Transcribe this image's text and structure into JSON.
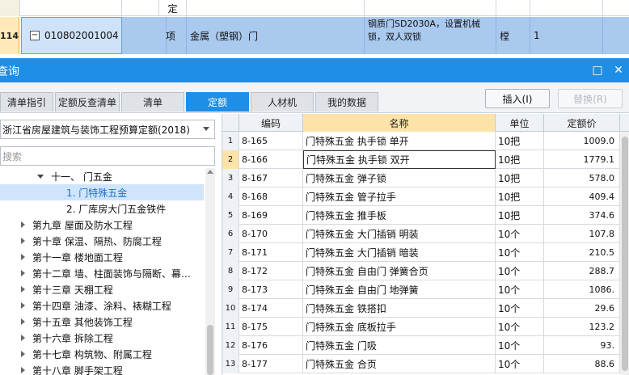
{
  "top_grid": {
    "row1_unit": "定",
    "row_number": "114",
    "expand_symbol": "−",
    "code": "010802001004",
    "type": "项",
    "name": "金属（塑钢）门",
    "note_line1": "钢质门SD2030A，设置机械",
    "note_line2": "锁，双人双锁",
    "unit": "樘",
    "qty": "1"
  },
  "window": {
    "title": "查询",
    "restore_glyph": "□",
    "close_glyph": "✕"
  },
  "tabs": [
    {
      "label": "清单指引"
    },
    {
      "label": "定额反查清单"
    },
    {
      "label": "清单"
    },
    {
      "label": "定额"
    },
    {
      "label": "人材机"
    },
    {
      "label": "我的数据"
    }
  ],
  "actions": {
    "insert_label": "插入(I)",
    "replace_label": "替换(R)"
  },
  "left_panel": {
    "library": "浙江省房屋建筑与装饰工程预算定额(2018)",
    "search_placeholder": "搜索",
    "tree": [
      {
        "label": "十一、 门五金"
      },
      {
        "label": "1. 门特殊五金"
      },
      {
        "label": "2. 厂库房大门五金铁件"
      },
      {
        "label": "第九章 屋面及防水工程"
      },
      {
        "label": "第十章 保温、隔热、防腐工程"
      },
      {
        "label": "第十一章 楼地面工程"
      },
      {
        "label": "第十二章 墙、柱面装饰与隔断、幕…"
      },
      {
        "label": "第十三章 天棚工程"
      },
      {
        "label": "第十四章 油漆、涂料、裱糊工程"
      },
      {
        "label": "第十五章 其他装饰工程"
      },
      {
        "label": "第十六章 拆除工程"
      },
      {
        "label": "第十七章 构筑物、附属工程"
      },
      {
        "label": "第十八章 脚手架工程"
      }
    ]
  },
  "grid": {
    "headers": {
      "code": "编码",
      "name": "名称",
      "unit": "单位",
      "price": "定额价"
    },
    "rows": [
      {
        "n": "1",
        "code": "8-165",
        "name": "门特殊五金 执手锁 单开",
        "unit": "10把",
        "price": "1009.0"
      },
      {
        "n": "2",
        "code": "8-166",
        "name": "门特殊五金 执手锁 双开",
        "unit": "10把",
        "price": "1779.1"
      },
      {
        "n": "3",
        "code": "8-167",
        "name": "门特殊五金 弹子锁",
        "unit": "10把",
        "price": "578.0"
      },
      {
        "n": "4",
        "code": "8-168",
        "name": "门特殊五金 管子拉手",
        "unit": "10把",
        "price": "409.4"
      },
      {
        "n": "5",
        "code": "8-169",
        "name": "门特殊五金 推手板",
        "unit": "10把",
        "price": "374.6"
      },
      {
        "n": "6",
        "code": "8-170",
        "name": "门特殊五金 大门插销 明装",
        "unit": "10个",
        "price": "107.8"
      },
      {
        "n": "7",
        "code": "8-171",
        "name": "门特殊五金 大门插销 暗装",
        "unit": "10个",
        "price": "210.5"
      },
      {
        "n": "8",
        "code": "8-172",
        "name": "门特殊五金 自由门 弹簧合页",
        "unit": "10个",
        "price": "288.7"
      },
      {
        "n": "9",
        "code": "8-173",
        "name": "门特殊五金 自由门 地弹簧",
        "unit": "10个",
        "price": "1086."
      },
      {
        "n": "10",
        "code": "8-174",
        "name": "门特殊五金 铁搭扣",
        "unit": "10个",
        "price": "29.6"
      },
      {
        "n": "11",
        "code": "8-175",
        "name": "门特殊五金 底板拉手",
        "unit": "10个",
        "price": "123.2"
      },
      {
        "n": "12",
        "code": "8-176",
        "name": "门特殊五金 门吸",
        "unit": "10个",
        "price": "93."
      },
      {
        "n": "13",
        "code": "8-177",
        "name": "门特殊五金 合页",
        "unit": "10个",
        "price": "88.6"
      }
    ]
  }
}
